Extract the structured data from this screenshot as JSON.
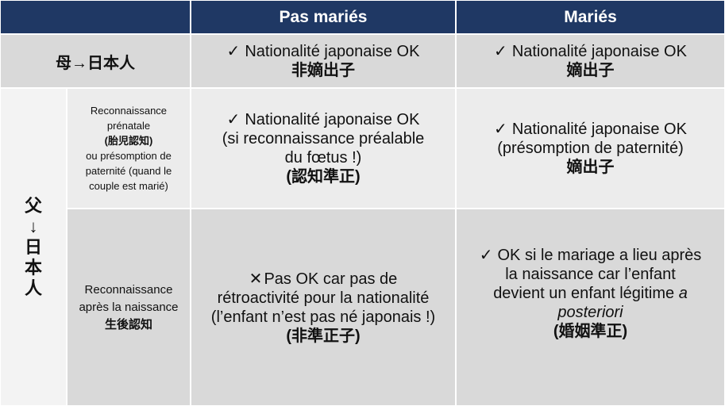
{
  "header": {
    "col_unmarried": "Pas mariés",
    "col_married": "Mariés"
  },
  "row_mother": {
    "label": "母→日本人",
    "unmarried": {
      "check": "✓",
      "text": "Nationalité japonaise OK",
      "jp": "非嫡出子"
    },
    "married": {
      "check": "✓",
      "text": "Nationalité japonaise OK",
      "jp": "嫡出子"
    }
  },
  "row_father": {
    "label_chars": [
      "父",
      "↓",
      "日",
      "本",
      "人"
    ],
    "prenatal": {
      "label_lines": [
        "Reconnaissance",
        "prénatale",
        "(胎児認知)",
        "ou présomption de",
        "paternité  (quand le",
        "couple est marié)"
      ],
      "unmarried": {
        "check": "✓",
        "lines": [
          "Nationalité japonaise OK",
          "(si reconnaissance préalable",
          "du fœtus !)"
        ],
        "jp": "(認知準正)"
      },
      "married": {
        "check": "✓",
        "lines": [
          "Nationalité japonaise OK",
          "(présomption de paternité)"
        ],
        "jp": "嫡出子"
      }
    },
    "postnatal": {
      "label_lines": [
        "Reconnaissance",
        "après la naissance"
      ],
      "label_jp": "生後認知",
      "unmarried": {
        "cross": "✕",
        "lines": [
          "Pas OK car pas de",
          "rétroactivité pour la nationalité",
          "(l’enfant n’est pas né japonais !)"
        ],
        "jp": "(非準正子)"
      },
      "married": {
        "check": "✓",
        "lines": [
          "OK si le mariage a lieu après",
          "la naissance car l’enfant",
          "devient un enfant légitime"
        ],
        "italic_a": "a",
        "italic_posteriori": "posteriori",
        "jp": "(婚姻準正)"
      }
    }
  },
  "colors": {
    "header_bg": "#1f3864",
    "header_text": "#ffffff",
    "cell_dark": "#d9d9d9",
    "cell_mid": "#ececec",
    "cell_light": "#f3f3f3"
  }
}
